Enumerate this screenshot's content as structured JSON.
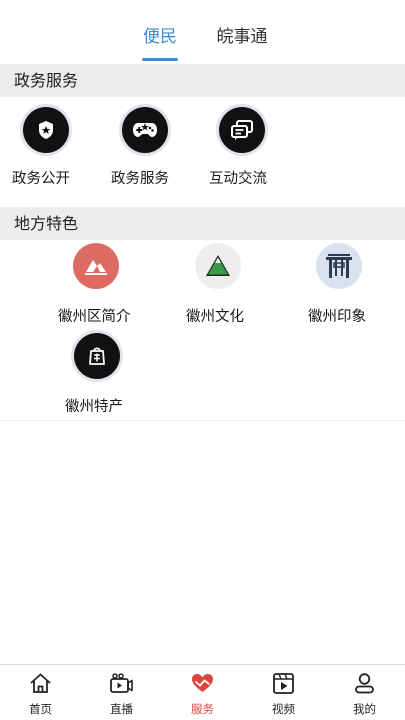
{
  "tabs": [
    {
      "label": "便民",
      "active": true
    },
    {
      "label": "皖事通",
      "active": false
    }
  ],
  "sections": {
    "gov": {
      "title": "政务服务",
      "items": [
        {
          "label": "政务公开",
          "icon": "police-badge-icon"
        },
        {
          "label": "政务服务",
          "icon": "gamepad-icon"
        },
        {
          "label": "互动交流",
          "icon": "chat-bubbles-icon"
        }
      ]
    },
    "local": {
      "title": "地方特色",
      "items": [
        {
          "label": "徽州区简介",
          "icon": "mountain-road-icon"
        },
        {
          "label": "徽州文化",
          "icon": "green-mountain-icon"
        },
        {
          "label": "徽州印象",
          "icon": "archway-icon"
        },
        {
          "label": "徽州特产",
          "icon": "specialty-bag-icon"
        }
      ]
    }
  },
  "bottom_nav": [
    {
      "label": "首页",
      "icon": "home-icon",
      "active": false
    },
    {
      "label": "直播",
      "icon": "live-camera-icon",
      "active": false
    },
    {
      "label": "服务",
      "icon": "heart-service-icon",
      "active": true
    },
    {
      "label": "视频",
      "icon": "video-play-icon",
      "active": false
    },
    {
      "label": "我的",
      "icon": "user-icon",
      "active": false
    }
  ],
  "colors": {
    "accent": "#3f8ad6",
    "nav_active": "#e0443e",
    "section_bg": "#ececec"
  }
}
